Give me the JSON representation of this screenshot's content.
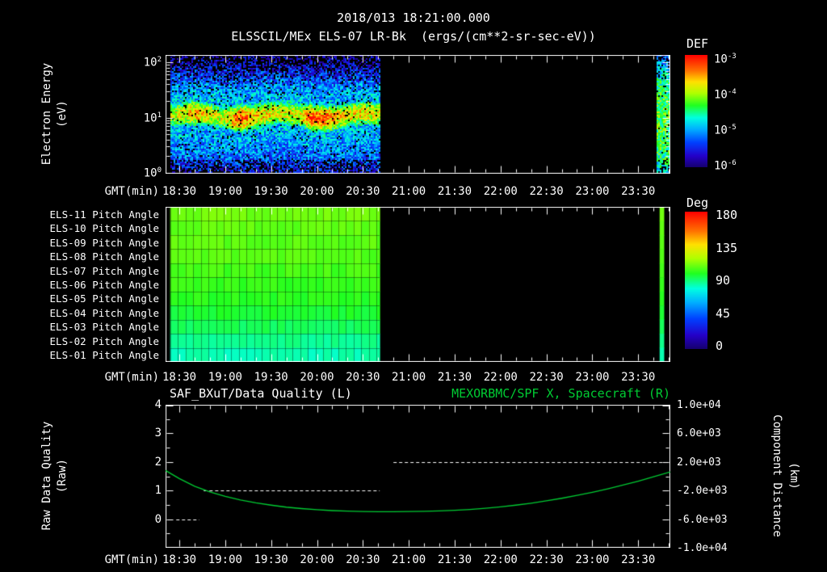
{
  "page": {
    "title_datetime": "2018/013 18:21:00.000",
    "title_main": "ELSSCIL/MEx ELS-07 LR-Bk",
    "title_units": "(ergs/(cm**2-sr-sec-eV))"
  },
  "colors": {
    "background": "#000000",
    "text": "#ffffff",
    "accent_green": "#00cc33",
    "quality_white": "#ffffff"
  },
  "colormap": [
    [
      0.0,
      "#16006e"
    ],
    [
      0.1,
      "#2400c8"
    ],
    [
      0.22,
      "#0040ff"
    ],
    [
      0.34,
      "#00b0ff"
    ],
    [
      0.44,
      "#00ffe0"
    ],
    [
      0.55,
      "#20ff20"
    ],
    [
      0.66,
      "#b0ff00"
    ],
    [
      0.76,
      "#ffe000"
    ],
    [
      0.86,
      "#ff7000"
    ],
    [
      1.0,
      "#ff0000"
    ]
  ],
  "time_axis": {
    "label": "GMT(min)",
    "start_min": 1101,
    "end_min": 1431,
    "minor_step_min": 10,
    "ticks": [
      {
        "label": "18:30",
        "min": 1110
      },
      {
        "label": "19:00",
        "min": 1140
      },
      {
        "label": "19:30",
        "min": 1170
      },
      {
        "label": "20:00",
        "min": 1200
      },
      {
        "label": "20:30",
        "min": 1230
      },
      {
        "label": "21:00",
        "min": 1260
      },
      {
        "label": "21:30",
        "min": 1290
      },
      {
        "label": "22:00",
        "min": 1320
      },
      {
        "label": "22:30",
        "min": 1350
      },
      {
        "label": "23:00",
        "min": 1380
      },
      {
        "label": "23:30",
        "min": 1410
      }
    ]
  },
  "chart_data": [
    {
      "type": "heatmap",
      "id": "energy-spectrogram",
      "title": "ELSSCIL/MEx ELS-07 LR-Bk (ergs/(cm**2-sr-sec-eV))",
      "ylabel_lines": [
        "Electron Energy",
        "(eV)"
      ],
      "yscale": "log",
      "ylim_ev": [
        1,
        140
      ],
      "ytick_exponents": [
        0,
        1,
        2
      ],
      "colorbar": {
        "title": "DEF",
        "scale": "log",
        "tick_exponents": [
          -3,
          -4,
          -5,
          -6
        ],
        "range_exponents": [
          -6,
          -3
        ]
      },
      "regions": [
        {
          "start_min": 1104,
          "end_min": 1241,
          "band_center_log_ev": 1.06,
          "band_sigma_log": 0.15,
          "band_peak_exp": -3.9,
          "intensity_bumps": [
            [
              1121,
              5,
              0.3
            ],
            [
              1149,
              4,
              0.55
            ],
            [
              1160,
              7,
              0.25
            ],
            [
              1196,
              5,
              0.45
            ],
            [
              1206,
              6,
              0.4
            ],
            [
              1228,
              9,
              0.15
            ]
          ],
          "halo_base_exp": -5.45,
          "halo_amp_exp": 0.6,
          "halo_sigma_log": 0.55,
          "description": "dense speckled electron spectrum with intense 8-25 eV band"
        },
        {
          "start_min": 1421,
          "end_min": 1430,
          "center_log_ev": 1.0,
          "sigma_log": 0.7,
          "base_exp": -4.8,
          "amp_exp": 0.5,
          "description": "narrow cyan-green data strip near 23:45"
        }
      ]
    },
    {
      "type": "heatmap",
      "id": "pitch-angles",
      "colorbar": {
        "title": "Deg",
        "ticks": [
          0,
          45,
          90,
          135,
          180
        ],
        "range_deg": [
          0,
          180
        ]
      },
      "rows": [
        {
          "label": "ELS-11 Pitch Angle",
          "angle_deg": 110
        },
        {
          "label": "ELS-10 Pitch Angle",
          "angle_deg": 108
        },
        {
          "label": "ELS-09 Pitch Angle",
          "angle_deg": 107
        },
        {
          "label": "ELS-08 Pitch Angle",
          "angle_deg": 106
        },
        {
          "label": "ELS-07 Pitch Angle",
          "angle_deg": 104
        },
        {
          "label": "ELS-06 Pitch Angle",
          "angle_deg": 102
        },
        {
          "label": "ELS-05 Pitch Angle",
          "angle_deg": 100
        },
        {
          "label": "ELS-04 Pitch Angle",
          "angle_deg": 97
        },
        {
          "label": "ELS-03 Pitch Angle",
          "angle_deg": 93
        },
        {
          "label": "ELS-02 Pitch Angle",
          "angle_deg": 88
        },
        {
          "label": "ELS-01 Pitch Angle",
          "angle_deg": 84
        }
      ],
      "regions": [
        {
          "start_min": 1104,
          "end_min": 1241,
          "cell_min": 5
        },
        {
          "start_min": 1424,
          "end_min": 1427
        }
      ]
    },
    {
      "type": "line",
      "id": "quality-and-distance",
      "title_left": "SAF_BXuT/Data Quality (L)",
      "title_right": "MEXORBMC/SPF X, Spacecraft (R)",
      "ylabel_left_lines": [
        "Raw Data Quality",
        "(Raw)"
      ],
      "ylabel_right_lines": [
        "Component Distance",
        "(km)"
      ],
      "y_left_range": [
        -1,
        4
      ],
      "yticks_left": [
        4,
        3,
        2,
        1,
        0
      ],
      "y_right_range_km": [
        -10000,
        10000
      ],
      "yticks_right_labels": [
        "1.0e+04",
        "6.0e+03",
        "2.0e+03",
        "-2.0e+03",
        "-6.0e+03",
        "-1.0e+04"
      ],
      "series": [
        {
          "name": "SAF_BXuT/Data Quality (L)",
          "axis": "left",
          "style": "dashed",
          "color": "#ffffff",
          "segments": [
            {
              "start_min": 1108,
              "end_min": 1123,
              "value": 0
            },
            {
              "start_min": 1126,
              "end_min": 1241,
              "value": 1
            },
            {
              "start_min": 1250,
              "end_min": 1431,
              "value": 2
            }
          ]
        },
        {
          "name": "MEXORBMC/SPF X, Spacecraft (R)",
          "axis": "right",
          "style": "solid",
          "color": "#00cc33",
          "points_min_km": [
            [
              1101,
              800
            ],
            [
              1110,
              -320
            ],
            [
              1120,
              -1400
            ],
            [
              1130,
              -2200
            ],
            [
              1140,
              -2800
            ],
            [
              1150,
              -3320
            ],
            [
              1160,
              -3720
            ],
            [
              1170,
              -4040
            ],
            [
              1180,
              -4320
            ],
            [
              1190,
              -4520
            ],
            [
              1200,
              -4680
            ],
            [
              1210,
              -4800
            ],
            [
              1220,
              -4880
            ],
            [
              1230,
              -4940
            ],
            [
              1240,
              -4960
            ],
            [
              1250,
              -4960
            ],
            [
              1260,
              -4940
            ],
            [
              1270,
              -4900
            ],
            [
              1280,
              -4840
            ],
            [
              1290,
              -4760
            ],
            [
              1300,
              -4640
            ],
            [
              1310,
              -4480
            ],
            [
              1320,
              -4280
            ],
            [
              1330,
              -4040
            ],
            [
              1340,
              -3760
            ],
            [
              1350,
              -3440
            ],
            [
              1360,
              -3080
            ],
            [
              1370,
              -2680
            ],
            [
              1380,
              -2240
            ],
            [
              1390,
              -1760
            ],
            [
              1400,
              -1240
            ],
            [
              1410,
              -680
            ],
            [
              1420,
              -80
            ],
            [
              1431,
              600
            ]
          ]
        }
      ]
    }
  ]
}
